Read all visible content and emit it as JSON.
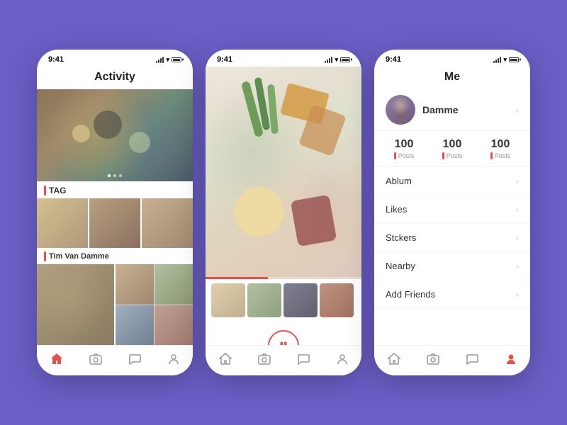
{
  "phone1": {
    "status": {
      "time": "9:41"
    },
    "header": {
      "title": "Activity",
      "search_aria": "search"
    },
    "carousel_dots": 3,
    "tag_label": "TAG",
    "name_label": "Tim Van Damme",
    "nav": [
      "home",
      "camera",
      "chat",
      "profile"
    ]
  },
  "phone2": {
    "status": {
      "time": "9:41"
    },
    "controls": {
      "prev": "‹",
      "next": "›"
    },
    "nav": [
      "home",
      "camera",
      "chat",
      "profile"
    ]
  },
  "phone3": {
    "status": {
      "time": "9:41"
    },
    "header": {
      "title": "Me"
    },
    "profile": {
      "name": "Damme"
    },
    "stats": [
      {
        "number": "100",
        "label": "Posts"
      },
      {
        "number": "100",
        "label": "Posts"
      },
      {
        "number": "100",
        "label": "Posts"
      }
    ],
    "menu_items": [
      {
        "label": "Ablum"
      },
      {
        "label": "Likes"
      },
      {
        "label": "Stckers"
      },
      {
        "label": "Nearby"
      },
      {
        "label": "Add Friends"
      }
    ],
    "nav": [
      "home",
      "camera",
      "chat",
      "profile"
    ]
  }
}
